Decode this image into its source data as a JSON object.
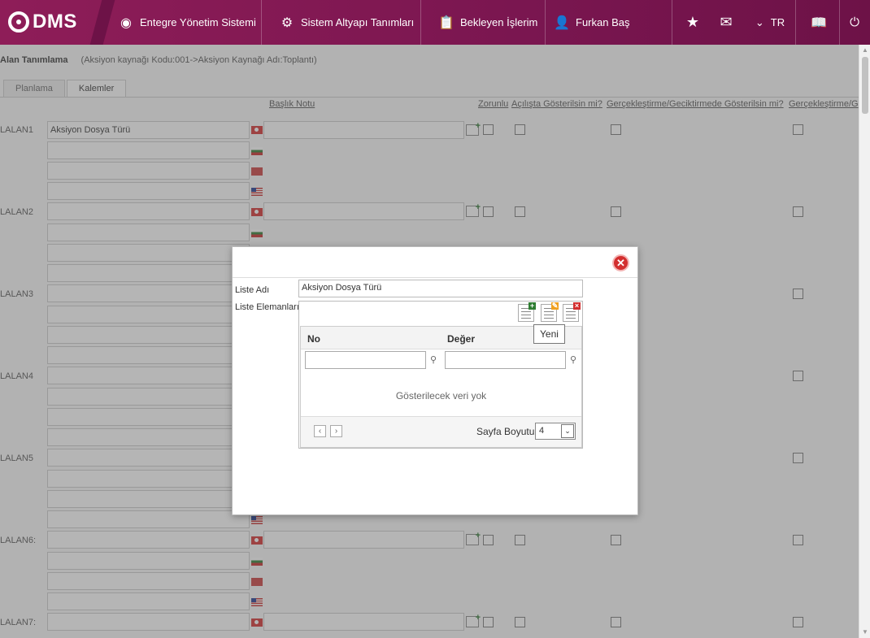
{
  "topbar": {
    "logo_text": "DMS",
    "nav": [
      "Entegre Yönetim Sistemi",
      "Sistem Altyapı Tanımları",
      "Bekleyen İşlerim",
      "Furkan Baş"
    ],
    "lang": "TR"
  },
  "page": {
    "title": "Alan Tanımlama",
    "context": "(Aksiyon kaynağı Kodu:001->Aksiyon Kaynağı Adı:Toplantı)",
    "tabs": [
      "Planlama",
      "Kalemler"
    ],
    "columns": [
      "Başlık Notu",
      "Zorunlu",
      "Açılışta Gösterilsin mi?",
      "Gerçekleştirme/Geciktirmede Gösterilsin mi?",
      "Gerçekleştirme/G"
    ]
  },
  "rows": [
    {
      "label": "LALAN1",
      "value": "Aksiyon Dosya Türü"
    },
    {
      "label": "LALAN2",
      "value": ""
    },
    {
      "label": "LALAN3",
      "value": ""
    },
    {
      "label": "LALAN4",
      "value": ""
    },
    {
      "label": "LALAN5",
      "value": ""
    },
    {
      "label": "LALAN6:",
      "value": ""
    },
    {
      "label": "LALAN7:",
      "value": ""
    }
  ],
  "modal": {
    "list_name_label": "Liste Adı",
    "list_name_value": "Aksiyon Dosya Türü",
    "list_items_label": "Liste Elemanları",
    "grid": {
      "col_no": "No",
      "col_value": "Değer",
      "empty": "Gösterilecek veri yok",
      "page_size_label": "Sayfa Boyutu:",
      "page_size_value": "4"
    },
    "tooltip": "Yeni"
  }
}
